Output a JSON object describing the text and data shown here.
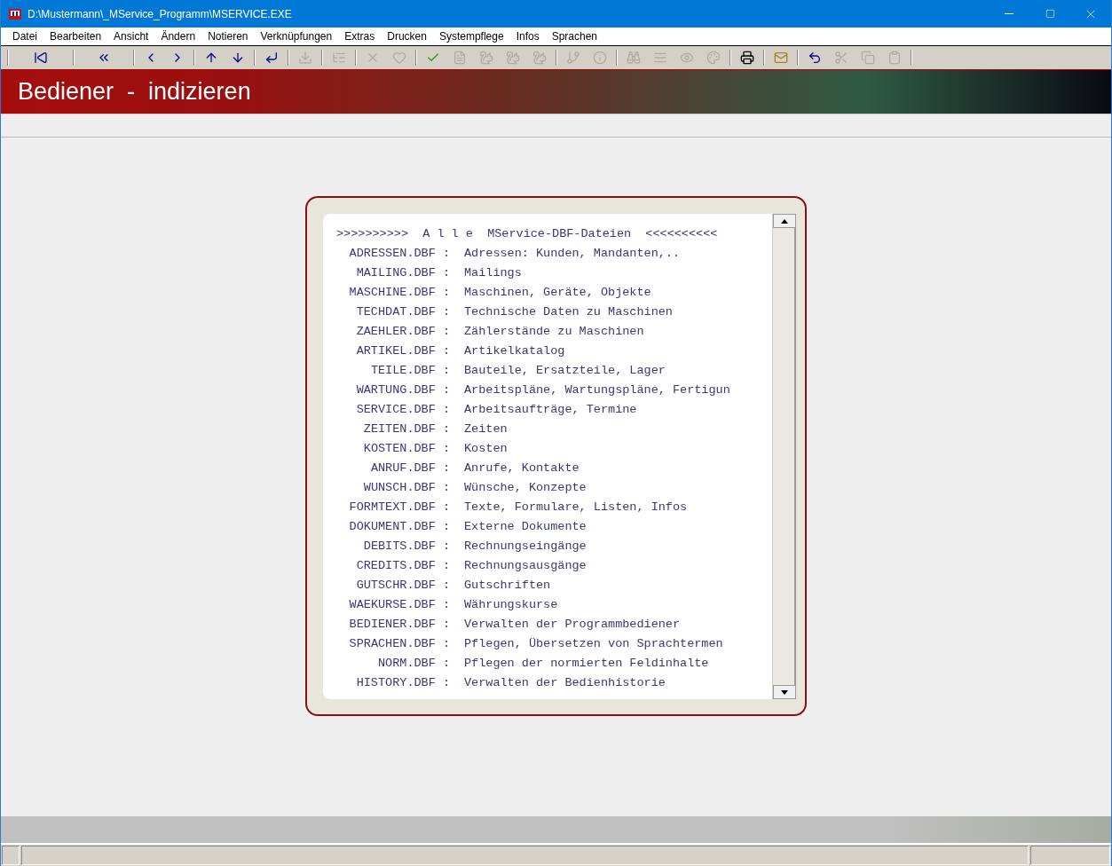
{
  "window": {
    "title": "D:\\Mustermann\\_MService_Programm\\MSERVICE.EXE"
  },
  "menu": [
    "Datei",
    "Bearbeiten",
    "Ansicht",
    "Ändern",
    "Notieren",
    "Verknüpfungen",
    "Extras",
    "Drucken",
    "Systempflege",
    "Infos",
    "Sprachen"
  ],
  "toolbar": [
    [
      {
        "kind": "first",
        "disabled": false
      }
    ],
    [
      {
        "kind": "rewind",
        "disabled": false
      }
    ],
    [
      {
        "kind": "prev",
        "disabled": false
      },
      {
        "kind": "next",
        "disabled": false
      }
    ],
    [
      {
        "kind": "up",
        "disabled": false
      },
      {
        "kind": "down",
        "disabled": false
      }
    ],
    [
      {
        "kind": "enter",
        "disabled": false
      }
    ],
    [
      {
        "kind": "import",
        "disabled": true
      }
    ],
    [
      {
        "kind": "tree",
        "disabled": true
      }
    ],
    [
      {
        "kind": "delete",
        "disabled": true
      },
      {
        "kind": "heart",
        "disabled": true
      }
    ],
    [
      {
        "kind": "check",
        "disabled": false
      },
      {
        "kind": "form",
        "disabled": true
      },
      {
        "kind": "squirrel",
        "disabled": true
      },
      {
        "kind": "squirrel",
        "disabled": true
      },
      {
        "kind": "squirrel",
        "disabled": true
      }
    ],
    [
      {
        "kind": "branch",
        "disabled": true
      },
      {
        "kind": "info",
        "disabled": true
      }
    ],
    [
      {
        "kind": "binoculars",
        "disabled": true
      },
      {
        "kind": "lines",
        "disabled": true
      },
      {
        "kind": "eye",
        "disabled": true
      },
      {
        "kind": "colors",
        "disabled": true
      }
    ],
    [
      {
        "kind": "printer",
        "disabled": false
      }
    ],
    [
      {
        "kind": "mail",
        "disabled": false
      }
    ],
    [
      {
        "kind": "undo",
        "disabled": false
      },
      {
        "kind": "cut",
        "disabled": true
      },
      {
        "kind": "copy",
        "disabled": true
      },
      {
        "kind": "paste",
        "disabled": true
      }
    ]
  ],
  "banner": {
    "title": "Bediener  -  indizieren"
  },
  "list": {
    "header": ">>>>>>>>>>  A l l e  MService-DBF-Dateien  <<<<<<<<<<",
    "rows": [
      {
        "file": "ADRESSEN.DBF :",
        "desc": "Adressen: Kunden, Mandanten,.."
      },
      {
        "file": "MAILING.DBF :",
        "desc": "Mailings"
      },
      {
        "file": "MASCHINE.DBF :",
        "desc": "Maschinen, Geräte, Objekte"
      },
      {
        "file": "TECHDAT.DBF :",
        "desc": "Technische Daten zu Maschinen"
      },
      {
        "file": "ZAEHLER.DBF :",
        "desc": "Zählerstände zu Maschinen"
      },
      {
        "file": "ARTIKEL.DBF :",
        "desc": "Artikelkatalog"
      },
      {
        "file": "TEILE.DBF :",
        "desc": "Bauteile, Ersatzteile, Lager"
      },
      {
        "file": "WARTUNG.DBF :",
        "desc": "Arbeitspläne, Wartungspläne, Fertigun"
      },
      {
        "file": "SERVICE.DBF :",
        "desc": "Arbeitsaufträge, Termine"
      },
      {
        "file": "ZEITEN.DBF :",
        "desc": "Zeiten"
      },
      {
        "file": "KOSTEN.DBF :",
        "desc": "Kosten"
      },
      {
        "file": "ANRUF.DBF :",
        "desc": "Anrufe, Kontakte"
      },
      {
        "file": "WUNSCH.DBF :",
        "desc": "Wünsche, Konzepte"
      },
      {
        "file": "FORMTEXT.DBF :",
        "desc": "Texte, Formulare, Listen, Infos"
      },
      {
        "file": "DOKUMENT.DBF :",
        "desc": "Externe Dokumente"
      },
      {
        "file": "DEBITS.DBF :",
        "desc": "Rechnungseingänge"
      },
      {
        "file": "CREDITS.DBF :",
        "desc": "Rechnungsausgänge"
      },
      {
        "file": "GUTSCHR.DBF :",
        "desc": "Gutschriften"
      },
      {
        "file": "WAEKURSE.DBF :",
        "desc": "Währungskurse"
      },
      {
        "file": "BEDIENER.DBF :",
        "desc": "Verwalten der Programmbediener"
      },
      {
        "file": "SPRACHEN.DBF :",
        "desc": "Pflegen, Übersetzen von Sprachtermen"
      },
      {
        "file": "NORM.DBF :",
        "desc": "Pflegen der normierten Feldinhalte"
      },
      {
        "file": "HISTORY.DBF :",
        "desc": "Verwalten der Bedienhistorie"
      }
    ]
  }
}
